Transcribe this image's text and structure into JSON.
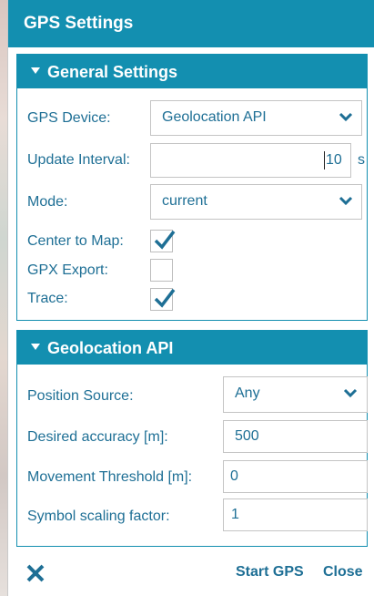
{
  "dialog": {
    "title": "GPS Settings"
  },
  "general": {
    "header": "General Settings",
    "gps_device": {
      "label": "GPS Device:",
      "value": "Geolocation API"
    },
    "update_interval": {
      "label": "Update Interval:",
      "value": "10",
      "unit": "s"
    },
    "mode": {
      "label": "Mode:",
      "value": "current"
    },
    "center_to_map": {
      "label": "Center to Map:",
      "checked": true
    },
    "gpx_export": {
      "label": "GPX Export:",
      "checked": false
    },
    "trace": {
      "label": "Trace:",
      "checked": true
    }
  },
  "geolocation": {
    "header": "Geolocation API",
    "position_source": {
      "label": "Position Source:",
      "value": "Any"
    },
    "desired_accuracy": {
      "label": "Desired accuracy [m]:",
      "value": "500"
    },
    "movement_threshold": {
      "label": "Movement Threshold [m]:",
      "value": "0"
    },
    "symbol_scaling": {
      "label": "Symbol scaling factor:",
      "value": "1"
    }
  },
  "footer": {
    "start_label": "Start GPS",
    "close_label": "Close"
  },
  "icons": {
    "close": "close-x-icon",
    "dropdown": "chevron-down-icon",
    "check": "checkmark-icon",
    "section_toggle": "caret-down-icon"
  },
  "colors": {
    "accent": "#138fb0",
    "text": "#1e6f95"
  }
}
